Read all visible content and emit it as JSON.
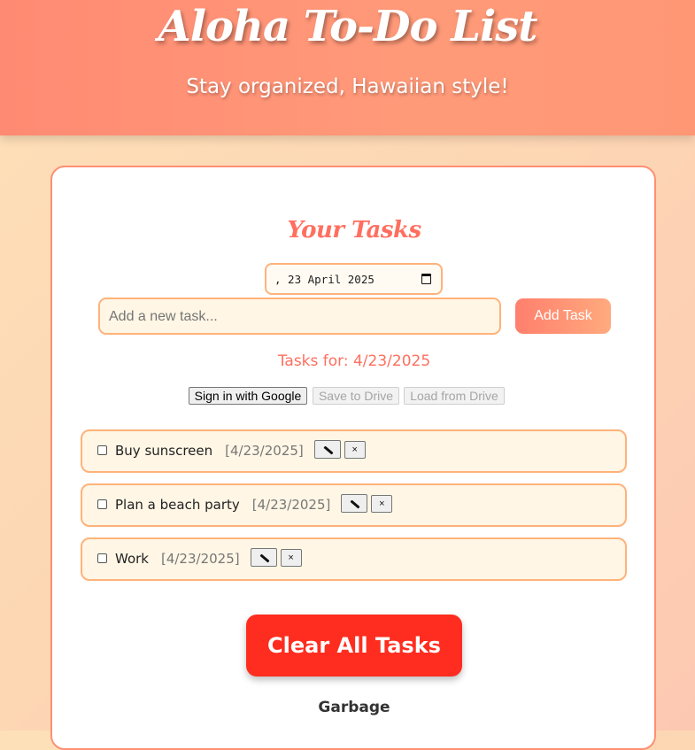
{
  "header": {
    "title": "Aloha To-Do List",
    "subtitle": "Stay organized, Hawaiian style!"
  },
  "main": {
    "section_title": "Your Tasks",
    "date_value": ", 23 April 2025",
    "task_input_placeholder": "Add a new task...",
    "add_button_label": "Add Task",
    "tasks_for_label": "Tasks for: 4/23/2025",
    "drive": {
      "sign_in_label": "Sign in with Google",
      "save_label": "Save to Drive",
      "load_label": "Load from Drive"
    },
    "tasks": [
      {
        "text": "Buy sunscreen",
        "date": "[4/23/2025]",
        "done": false
      },
      {
        "text": "Plan a beach party",
        "date": "[4/23/2025]",
        "done": false
      },
      {
        "text": "Work",
        "date": "[4/23/2025]",
        "done": false
      }
    ],
    "delete_glyph": "×",
    "clear_button_label": "Clear All Tasks",
    "garbage_label": "Garbage"
  },
  "colors": {
    "header": "#ff8a73",
    "accent": "#ff6f5f",
    "clear_button": "#ff2d1f",
    "task_background": "#fff6e5",
    "border": "#ffb27a"
  },
  "icons": {
    "date_picker": "calendar-icon",
    "edit": "pencil-icon"
  }
}
